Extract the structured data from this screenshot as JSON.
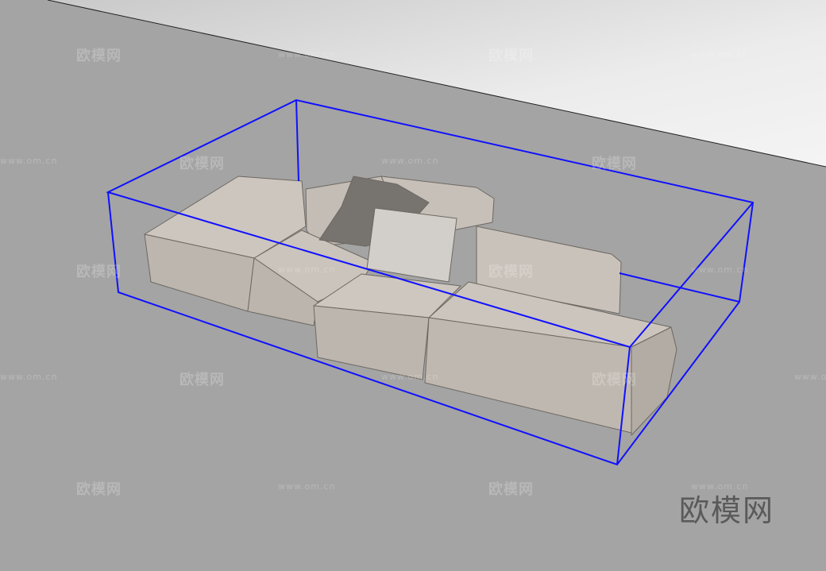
{
  "watermark": {
    "brand": "欧模网",
    "url": "www.om.cn"
  },
  "logo": {
    "text": "欧模网"
  },
  "colors": {
    "ground": "#a4a4a4",
    "sky_top": "#f0f0f0",
    "sky_bottom": "#c4c4c4",
    "bounding_box": "#1010ff",
    "sofa": "#c8c1b9",
    "pillow_dark": "#77736f",
    "pillow_light": "#d2cfcb"
  }
}
